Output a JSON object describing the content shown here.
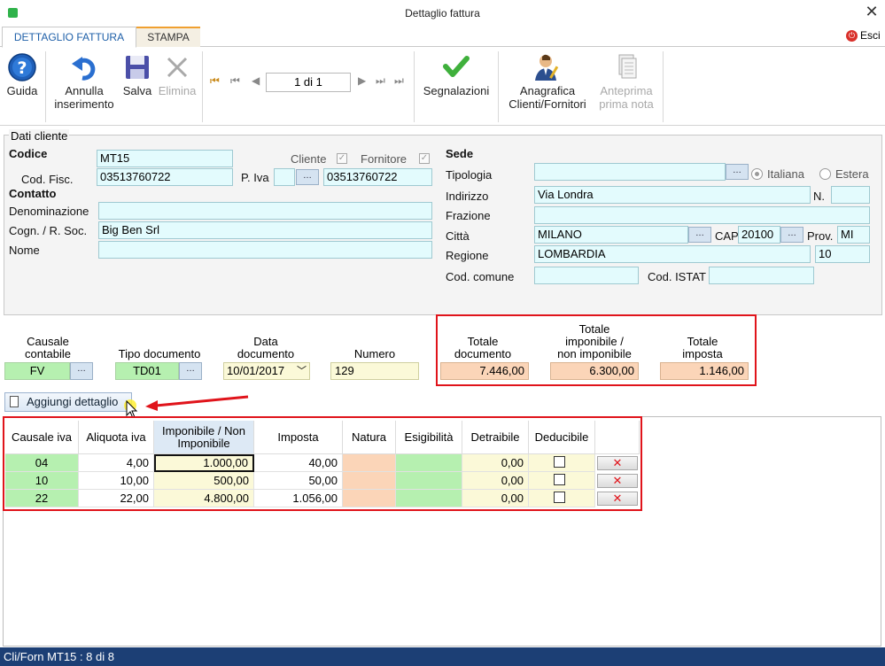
{
  "window": {
    "title": "Dettaglio fattura",
    "close_glyph": "✕"
  },
  "tabs": [
    {
      "label": "DETTAGLIO FATTURA"
    },
    {
      "label": "STAMPA"
    }
  ],
  "esci": {
    "label": "Esci",
    "icon": "exit-icon"
  },
  "toolbar": {
    "guida": "Guida",
    "annulla_1": "Annulla",
    "annulla_2": "inserimento",
    "salva": "Salva",
    "elimina": "Elimina",
    "record_position": "1 di 1",
    "segnalazioni": "Segnalazioni",
    "anagrafica_1": "Anagrafica",
    "anagrafica_2": "Clienti/Fornitori",
    "anteprima_1": "Anteprima",
    "anteprima_2": "prima nota"
  },
  "cliente": {
    "legend": "Dati cliente",
    "codice_label": "Codice",
    "codice": "MT15",
    "cliente_label": "Cliente",
    "fornitore_label": "Fornitore",
    "cod_fisc_label": "Cod. Fisc.",
    "cod_fisc": "03513760722",
    "piva_label": "P. Iva",
    "piva": "03513760722",
    "contatto_label": "Contatto",
    "denominazione_label": "Denominazione",
    "denominazione": "",
    "cognome_label": "Cogn. / R. Soc.",
    "cognome": "Big Ben Srl",
    "nome_label": "Nome",
    "nome": ""
  },
  "sede": {
    "title": "Sede",
    "tipologia_label": "Tipologia",
    "tipologia": "",
    "italiana_label": "Italiana",
    "estera_label": "Estera",
    "indirizzo_label": "Indirizzo",
    "indirizzo": "Via Londra",
    "n_label": "N.",
    "n": "",
    "frazione_label": "Frazione",
    "frazione": "",
    "citta_label": "Città",
    "citta": "MILANO",
    "cap_label": "CAP",
    "cap": "20100",
    "prov_label": "Prov.",
    "prov": "MI",
    "regione_label": "Regione",
    "regione": "LOMBARDIA",
    "regione_code": "10",
    "cod_comune_label": "Cod. comune",
    "cod_comune": "",
    "cod_istat_label": "Cod. ISTAT",
    "cod_istat": ""
  },
  "documento": {
    "causale_label_1": "Causale",
    "causale_label_2": "contabile",
    "causale": "FV",
    "tipo_label": "Tipo documento",
    "tipo": "TD01",
    "data_label_1": "Data",
    "data_label_2": "documento",
    "data": "10/01/2017",
    "numero_label": "Numero",
    "numero": "129"
  },
  "totali": {
    "tot_doc_label_1": "Totale",
    "tot_doc_label_2": "documento",
    "tot_doc": "7.446,00",
    "tot_imp_label_1": "Totale",
    "tot_imp_label_2": "imponibile /",
    "tot_imp_label_3": "non imponibile",
    "tot_imp": "6.300,00",
    "tot_iva_label_1": "Totale",
    "tot_iva_label_2": "imposta",
    "tot_iva": "1.146,00"
  },
  "add_button": {
    "label": "Aggiungi dettaglio"
  },
  "grid": {
    "headers": {
      "causale": "Causale iva",
      "aliquota": "Aliquota iva",
      "imponibile_1": "Imponibile / Non",
      "imponibile_2": "Imponibile",
      "imposta": "Imposta",
      "natura": "Natura",
      "esigibilita": "Esigibilità",
      "detraibile": "Detraibile",
      "deducibile": "Deducibile"
    },
    "rows": [
      {
        "causale": "04",
        "aliquota": "4,00",
        "imponibile": "1.000,00",
        "imposta": "40,00",
        "natura": "",
        "esigibilita": "",
        "detraibile": "0,00",
        "deducibile": false
      },
      {
        "causale": "10",
        "aliquota": "10,00",
        "imponibile": "500,00",
        "imposta": "50,00",
        "natura": "",
        "esigibilita": "",
        "detraibile": "0,00",
        "deducibile": false
      },
      {
        "causale": "22",
        "aliquota": "22,00",
        "imponibile": "4.800,00",
        "imposta": "1.056,00",
        "natura": "",
        "esigibilita": "",
        "detraibile": "0,00",
        "deducibile": false
      }
    ],
    "delete_glyph": "✕"
  },
  "status": {
    "text": "Cli/Forn MT15 : 8 di 8"
  },
  "colors": {
    "accent": "#1e5fa8",
    "status_bg": "#1c3f75",
    "highlight_red": "#e0141b",
    "field_cyan": "#e3fbfd",
    "field_green": "#b6f0b0",
    "field_orange": "#fbd5b8"
  }
}
